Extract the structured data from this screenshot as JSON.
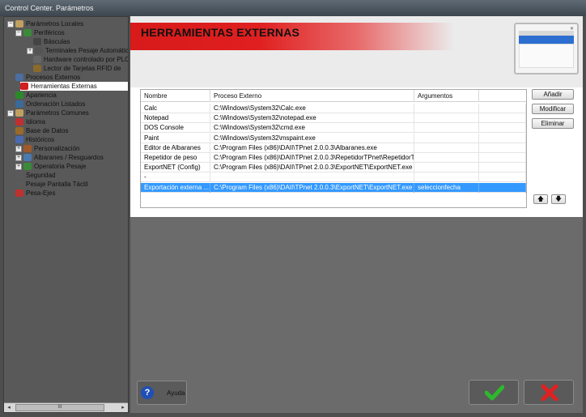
{
  "window": {
    "title": "Control Center. Parámetros"
  },
  "tree": {
    "items": [
      {
        "label": "Parámetros Locales",
        "expander": "−",
        "icon": "tools-icon",
        "color": "#c0a060"
      },
      {
        "label": "Periféricos",
        "expander": "−",
        "icon": "peripherals-icon",
        "color": "#3a8a3a"
      },
      {
        "label": "Básculas",
        "expander": "",
        "icon": "scale-icon",
        "color": "#444444"
      },
      {
        "label": "Terminales Pesaje Automático",
        "expander": "+",
        "icon": "terminal-icon",
        "color": "#555555"
      },
      {
        "label": "Hardware controlado por PLC",
        "expander": "",
        "icon": "hardware-icon",
        "color": "#666666"
      },
      {
        "label": "Lector de Tarjetas RFID de",
        "expander": "",
        "icon": "rfid-icon",
        "color": "#8a6a2a"
      },
      {
        "label": "Procesos Externos",
        "expander": "",
        "icon": "process-icon",
        "color": "#4a6fa0"
      },
      {
        "label": "Herramientas Externas",
        "expander": "",
        "icon": "external-tools-icon",
        "color": "#d02020"
      },
      {
        "label": "Apariencia",
        "expander": "",
        "icon": "appearance-icon",
        "color": "#2a8a2a"
      },
      {
        "label": "Ordenación Listados",
        "expander": "",
        "icon": "sort-icon",
        "color": "#3a6a9a"
      },
      {
        "label": "Parámetros Comunes",
        "expander": "−",
        "icon": "tools-icon",
        "color": "#c0a060"
      },
      {
        "label": "Idioma",
        "expander": "",
        "icon": "language-icon",
        "color": "#c03030"
      },
      {
        "label": "Base de Datos",
        "expander": "",
        "icon": "database-icon",
        "color": "#9a6a2a"
      },
      {
        "label": "Históricos",
        "expander": "",
        "icon": "history-icon",
        "color": "#4a6ab0"
      },
      {
        "label": "Personalización",
        "expander": "+",
        "icon": "customize-icon",
        "color": "#a05a2a"
      },
      {
        "label": "Albaranes / Resguardos",
        "expander": "+",
        "icon": "delivery-notes-icon",
        "color": "#4a7ab0"
      },
      {
        "label": "Operatoria Pesaje",
        "expander": "+",
        "icon": "weighing-icon",
        "color": "#3a8a3a"
      },
      {
        "label": "Seguridad",
        "expander": "",
        "icon": "security-icon",
        "color": "#5a5a5a"
      },
      {
        "label": "Pesaje Pantalla Táctil",
        "expander": "",
        "icon": "touch-icon",
        "color": "#5a5a5a"
      },
      {
        "label": "Pesa-Ejes",
        "expander": "",
        "icon": "axle-icon",
        "color": "#c03030"
      }
    ],
    "scroll_label": "III"
  },
  "header": {
    "title": "HERRAMIENTAS EXTERNAS"
  },
  "table": {
    "columns": [
      "Nombre",
      "Proceso Externo",
      "Argumentos"
    ],
    "rows": [
      {
        "name": "Calc",
        "process": "C:\\Windows\\System32\\Calc.exe",
        "args": ""
      },
      {
        "name": "Notepad",
        "process": "C:\\Windows\\System32\\notepad.exe",
        "args": ""
      },
      {
        "name": "DOS Console",
        "process": "C:\\Windows\\System32\\cmd.exe",
        "args": ""
      },
      {
        "name": "Paint",
        "process": "C:\\Windows\\System32\\mspaint.exe",
        "args": ""
      },
      {
        "name": "Editor de Albaranes",
        "process": "C:\\Program Files (x86)\\DAII\\TPnet 2.0.0.3\\Albaranes.exe",
        "args": ""
      },
      {
        "name": "Repetidor de peso",
        "process": "C:\\Program Files (x86)\\DAII\\TPnet 2.0.0.3\\RepetidorTPnet\\RepetidorT...",
        "args": ""
      },
      {
        "name": "ExportNET (Config)",
        "process": "C:\\Program Files (x86)\\DAII\\TPnet 2.0.0.3\\ExportNET\\ExportNET.exe",
        "args": ""
      },
      {
        "name": "-",
        "process": "",
        "args": ""
      },
      {
        "name": "Exportación externa ...",
        "process": "C:\\Program Files (x86)\\DAII\\TPnet 2.0.0.3\\ExportNET\\ExportNET.exe",
        "args": "seleccionfecha"
      }
    ],
    "selected_row": 8
  },
  "buttons": {
    "add": "Añadir",
    "modify": "Modificar",
    "delete": "Eliminar",
    "up": "🡅",
    "down": "🡇",
    "help": "Ayuda",
    "help_glyph": "?"
  },
  "colors": {
    "header_red": "#d81a1a",
    "selection": "#3399ff",
    "ok_green": "#2db82d",
    "cancel_red": "#e02020"
  }
}
